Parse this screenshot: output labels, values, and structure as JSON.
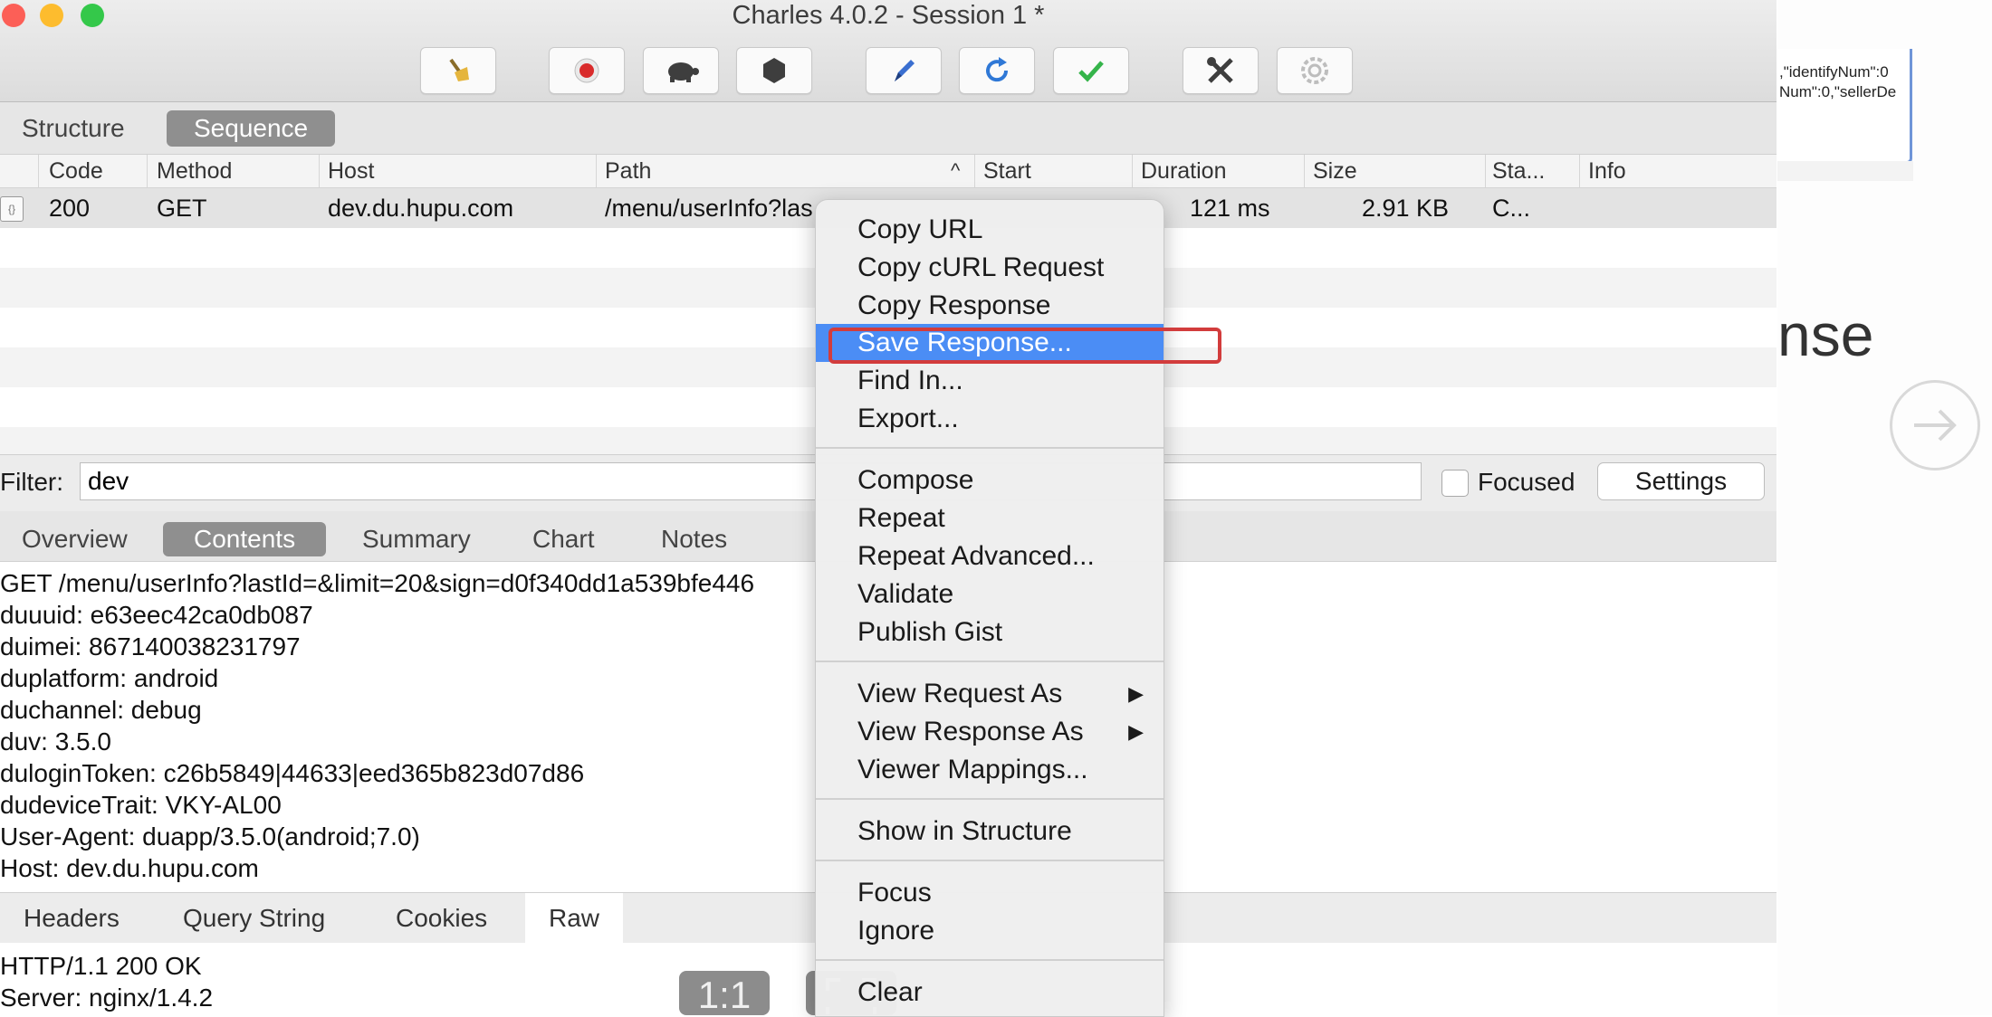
{
  "window": {
    "title": "Charles 4.0.2 - Session 1 *",
    "traffic_colors": [
      "#fc5f57",
      "#fdbc2e",
      "#34c84a"
    ]
  },
  "toolbar": {
    "buttons": [
      "broom-icon",
      "record-icon",
      "throttle-turtle-icon",
      "stop-hexagon-icon",
      "compose-pen-icon",
      "repeat-icon",
      "validate-check-icon",
      "tools-icon",
      "settings-gear-icon"
    ]
  },
  "view_tabs": {
    "structure": "Structure",
    "sequence": "Sequence"
  },
  "table": {
    "headers": [
      "Code",
      "Method",
      "Host",
      "Path",
      "Start",
      "Duration",
      "Size",
      "Sta...",
      "Info"
    ],
    "sort_indicator": "^",
    "rows": [
      {
        "code": "200",
        "method": "GET",
        "host": "dev.du.hupu.com",
        "path": "/menu/userInfo?las",
        "duration": "121 ms",
        "size": "2.91 KB",
        "status": "C..."
      }
    ]
  },
  "filter": {
    "label": "Filter:",
    "value": "dev",
    "focused_label": "Focused",
    "settings_label": "Settings"
  },
  "detail_tabs": {
    "overview": "Overview",
    "contents": "Contents",
    "summary": "Summary",
    "chart": "Chart",
    "notes": "Notes"
  },
  "request_lines": [
    "GET /menu/userInfo?lastId=&limit=20&sign=d0f340dd1a539bfe446",
    "duuuid: e63eec42ca0db087",
    "duimei: 867140038231797",
    "duplatform: android",
    "duchannel: debug",
    "duv: 3.5.0",
    "duloginToken: c26b5849|44633|eed365b823d07d86",
    "dudeviceTrait: VKY-AL00",
    "User-Agent: duapp/3.5.0(android;7.0)",
    "Host: dev.du.hupu.com"
  ],
  "sub_tabs": {
    "headers": "Headers",
    "query": "Query String",
    "cookies": "Cookies",
    "raw": "Raw"
  },
  "response_lines": [
    "HTTP/1.1 200 OK",
    "Server: nginx/1.4.2"
  ],
  "overlay": {
    "one_to_one": "1:1"
  },
  "backdrop": {
    "snippet1": ",\"identifyNum\":0",
    "snippet2": "Num\":0,\"sellerDe",
    "big_text": "nse"
  },
  "menu": {
    "copy_url": "Copy URL",
    "copy_curl": "Copy cURL Request",
    "copy_response": "Copy Response",
    "save_response": "Save Response...",
    "find_in": "Find In...",
    "export": "Export...",
    "compose": "Compose",
    "repeat": "Repeat",
    "repeat_advanced": "Repeat Advanced...",
    "validate": "Validate",
    "publish_gist": "Publish Gist",
    "view_request_as": "View Request As",
    "view_response_as": "View Response As",
    "viewer_mappings": "Viewer Mappings...",
    "show_in_structure": "Show in Structure",
    "focus": "Focus",
    "ignore": "Ignore",
    "clear": "Clear",
    "submenu_arrow": "▶"
  },
  "highlight_color": "#d23c3c",
  "selection_color": "#4b8df5"
}
